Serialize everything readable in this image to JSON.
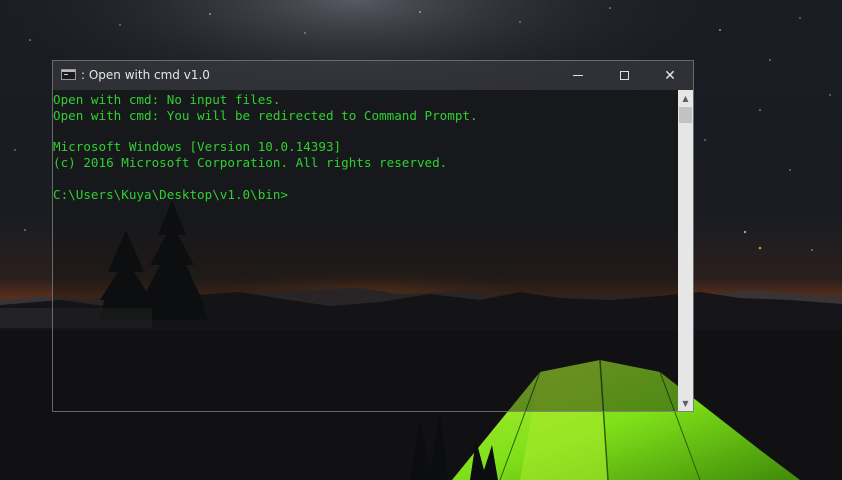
{
  "window": {
    "title": ": Open with cmd v1.0",
    "controls": {
      "minimize": "minimize",
      "maximize": "maximize",
      "close": "✕"
    }
  },
  "console": {
    "lines": [
      "Open with cmd: No input files.",
      "Open with cmd: You will be redirected to Command Prompt.",
      "",
      "Microsoft Windows [Version 10.0.14393]",
      "(c) 2016 Microsoft Corporation. All rights reserved.",
      "",
      "C:\\Users\\Kuya\\Desktop\\v1.0\\bin>"
    ],
    "text_color": "#2fd12f"
  },
  "scrollbar": {
    "up_arrow": "▲",
    "down_arrow": "▼"
  },
  "colors": {
    "titlebar": "#3c3e42",
    "console_bg": "#121214",
    "scrollbar_track": "#e6e6e6",
    "tent_green": "#7fe019"
  }
}
